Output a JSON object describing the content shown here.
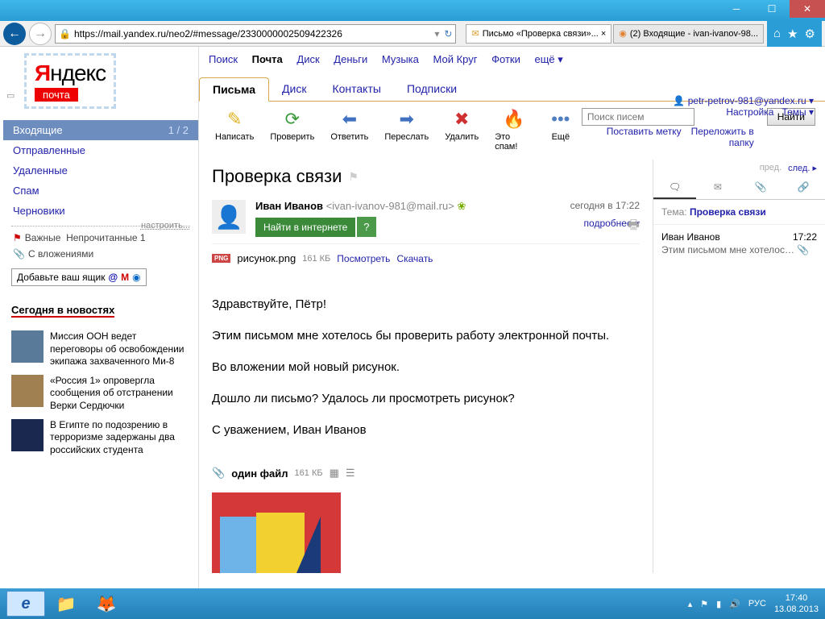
{
  "browser": {
    "url": "https://mail.yandex.ru/neo2/#message/2330000002509422326",
    "tabs": [
      {
        "label": "Письмо «Проверка связи»... ×"
      },
      {
        "label": "(2) Входящие - ivan-ivanov-98..."
      }
    ]
  },
  "topnav": {
    "items": [
      "Поиск",
      "Почта",
      "Диск",
      "Деньги",
      "Музыка",
      "Мой Круг",
      "Фотки"
    ],
    "more": "ещё ▾",
    "current": "Почта"
  },
  "user": {
    "email": "petr-petrov-981@yandex.ru ▾",
    "settings": "Настройка",
    "themes": "Темы ▾"
  },
  "logo": {
    "text": "Яндекс",
    "sub": "почта"
  },
  "maintabs": [
    "Письма",
    "Диск",
    "Контакты",
    "Подписки"
  ],
  "toolbar": {
    "write": "Написать",
    "check": "Проверить",
    "reply": "Ответить",
    "fwd": "Переслать",
    "del": "Удалить",
    "spam": "Это спам!",
    "more": "Ещё",
    "search_ph": "Поиск писем",
    "search_btn": "Найти",
    "tag": "Поставить метку",
    "move": "Переложить в папку"
  },
  "folders": {
    "inbox": "Входящие",
    "inbox_cnt": "1 / 2",
    "sent": "Отправленные",
    "trash": "Удаленные",
    "spam": "Спам",
    "drafts": "Черновики",
    "configure": "настроить...",
    "important": "Важные",
    "unread": "Непрочитанные",
    "unread_cnt": "1",
    "with_att": "С вложениями",
    "addbox": "Добавьте ваш ящик"
  },
  "news": {
    "header": "Сегодня в новостях",
    "items": [
      "Миссия ООН ведет переговоры об освобождении экипажа захваченного Ми-8",
      "«Россия 1» опровергла сообщения об отстранении Верки Сердючки",
      "В Египте по подозрению в терроризме задержаны два российских студента"
    ]
  },
  "message": {
    "subject": "Проверка связи",
    "from_name": "Иван Иванов",
    "from_addr": "<ivan-ivanov-981@mail.ru>",
    "find_btn": "Найти в интернете",
    "find_q": "?",
    "date": "сегодня в 17:22",
    "details": "подробнее ▾",
    "att_name": "рисунок.png",
    "att_size": "161 КБ",
    "att_view": "Посмотреть",
    "att_dl": "Скачать",
    "body": [
      "Здравствуйте, Пётр!",
      "Этим письмом мне хотелось бы проверить работу электронной почты.",
      "Во вложении мой новый рисунок.",
      "Дошло ли письмо? Удалось ли просмотреть рисунок?",
      "С уважением, Иван Иванов"
    ],
    "footer_files": "один файл",
    "footer_size": "161 КБ"
  },
  "sidepanel": {
    "prev": "пред.",
    "next": "след. ▸",
    "subject_lbl": "Тема:",
    "subject": "Проверка связи",
    "from": "Иван Иванов",
    "time": "17:22",
    "snippet": "Этим письмом мне хотелос…"
  },
  "taskbar": {
    "lang": "РУС",
    "time": "17:40",
    "date": "13.08.2013"
  }
}
